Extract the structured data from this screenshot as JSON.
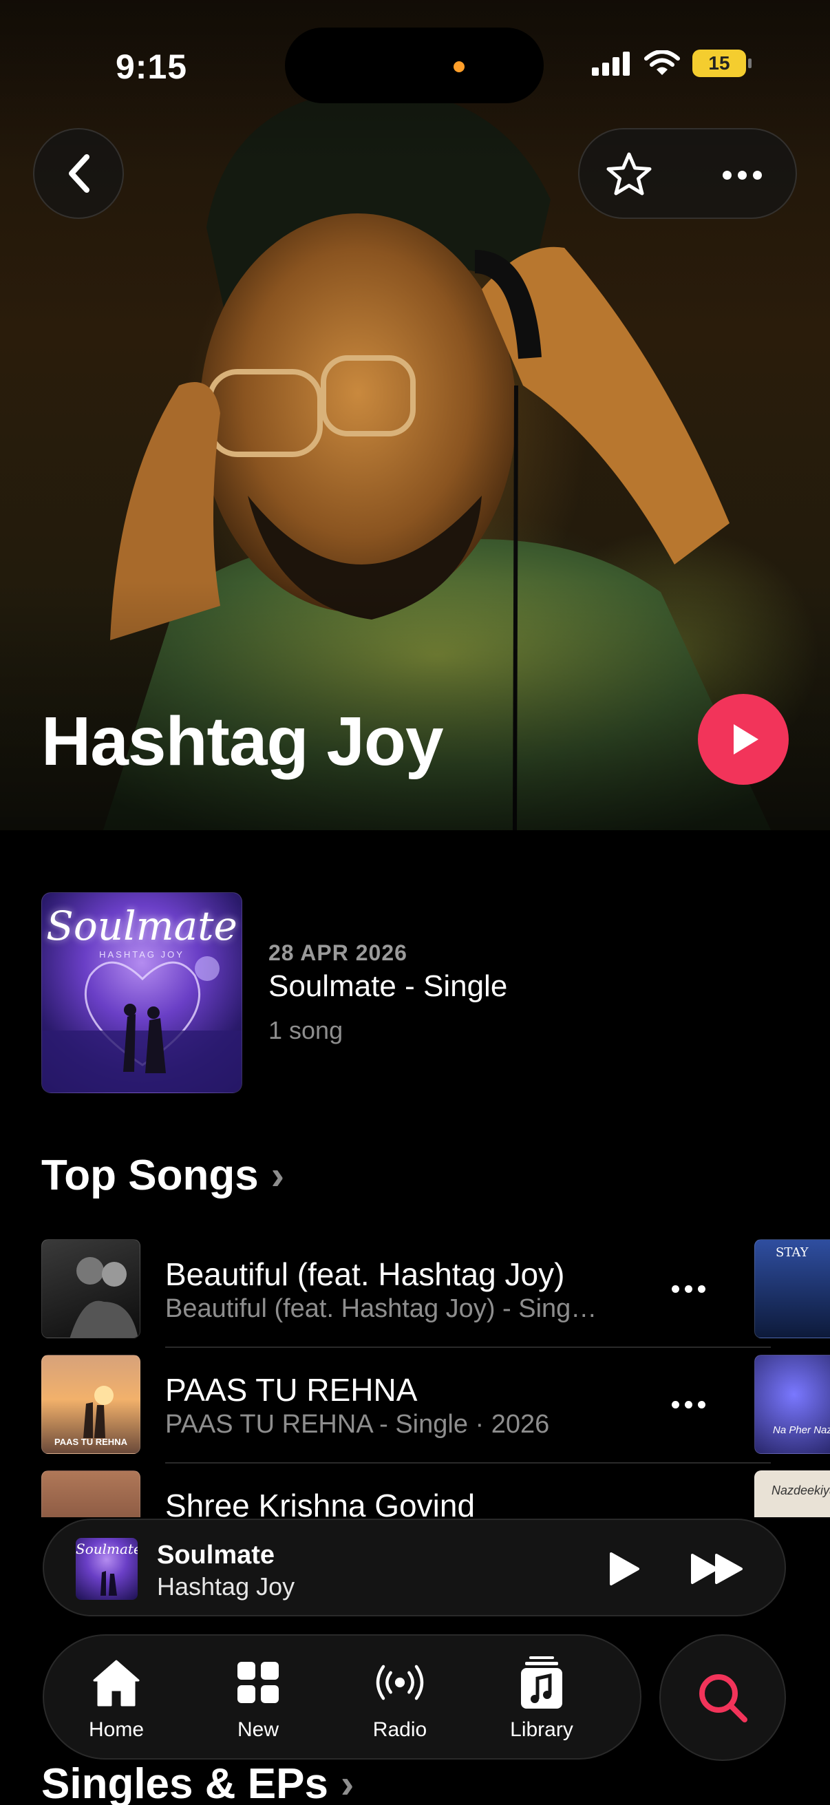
{
  "status_bar": {
    "time": "9:15",
    "battery": "15"
  },
  "artist": {
    "name": "Hashtag Joy"
  },
  "latest_release": {
    "date": "28 APR 2026",
    "title": "Soulmate - Single",
    "count": "1 song",
    "cover_title": "Soulmate",
    "cover_subtitle": "HASHTAG JOY"
  },
  "top_songs": {
    "heading": "Top Songs",
    "chevron": "›",
    "songs": [
      {
        "title": "Beautiful (feat. Hashtag Joy)",
        "subtitle": "Beautiful (feat. Hashtag Joy) - Sing…",
        "art_text": ""
      },
      {
        "title": "PAAS TU REHNA",
        "subtitle": "PAAS TU REHNA - Single · 2026",
        "art_text": "PAAS TU REHNA"
      },
      {
        "title": "Shree Krishna Govind",
        "subtitle": "",
        "art_text": ""
      }
    ],
    "side_art_text": [
      "STAY",
      "Na Pher Nazar",
      "Nazdeekiya"
    ]
  },
  "mini_player": {
    "title": "Soulmate",
    "artist": "Hashtag Joy",
    "art_text": "Soulmate"
  },
  "tabbar": {
    "items": [
      {
        "label": "Home",
        "icon": "house-icon"
      },
      {
        "label": "New",
        "icon": "grid-icon"
      },
      {
        "label": "Radio",
        "icon": "radio-waves-icon"
      },
      {
        "label": "Library",
        "icon": "music-library-icon"
      }
    ],
    "search_icon": "search-icon"
  },
  "singles_section": {
    "heading": "Singles & EPs",
    "chevron": "›"
  },
  "colors": {
    "accent": "#f2345a",
    "battery": "#f4cd2f",
    "island_dot": "#ff9f2a"
  }
}
